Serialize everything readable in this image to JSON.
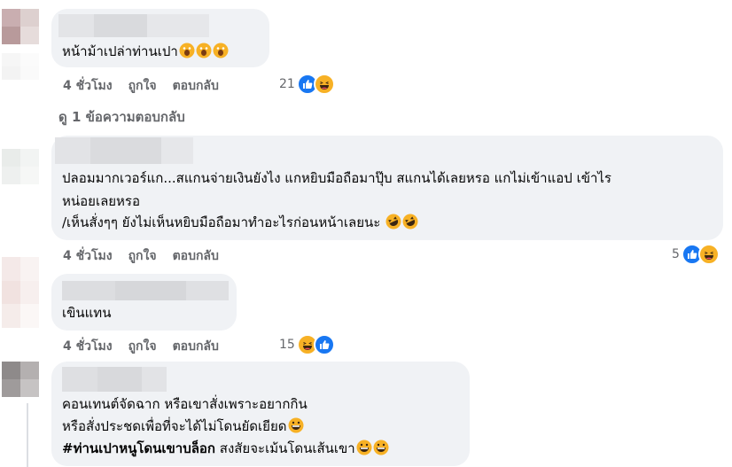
{
  "comments": [
    {
      "text": "หน้าม้าเปล่าท่านเปา",
      "time": "4 ชั่วโมง",
      "like_label": "ถูกใจ",
      "reply_label": "ตอบกลับ",
      "reaction_count": "21"
    },
    {
      "line1": "ปลอมมากเวอร์แก...สแกนจ่ายเงินยังไง แกหยิบมือถือมาปุ๊บ สแกนได้เลยหรอ แกไม่เข้าแอป เข้าไร",
      "line2": "หน่อยเลยหรอ",
      "line3": "/เห็นสั่งๆๆ ยังไม่เห็นหยิบมือถือมาทำอะไรก่อนหน้าเลยนะ",
      "time": "4 ชั่วโมง",
      "like_label": "ถูกใจ",
      "reply_label": "ตอบกลับ",
      "reaction_count": "5"
    },
    {
      "text": "เขินแทน",
      "time": "4 ชั่วโมง",
      "like_label": "ถูกใจ",
      "reply_label": "ตอบกลับ",
      "reaction_count": "15"
    },
    {
      "line1": "คอนเทนต์จัดฉาก หรือเขาสั่งเพราะอยากกิน",
      "line2": "หรือสั่งประชดเพื่อที่จะได้ไม่โดนยัดเยียด",
      "hashtag": "#ท่านเปาหนูโดนเขาบล็อก",
      "line3_rest": "สงสัยจะเม้นโดนเส้นเขา"
    }
  ],
  "view_replies": "ดู 1 ข้อความตอบกลับ",
  "colors": {
    "bubble": "#f0f2f5",
    "meta": "#65676b",
    "like_blue": "#1877f2",
    "haha_yellow": "#f7b125"
  }
}
